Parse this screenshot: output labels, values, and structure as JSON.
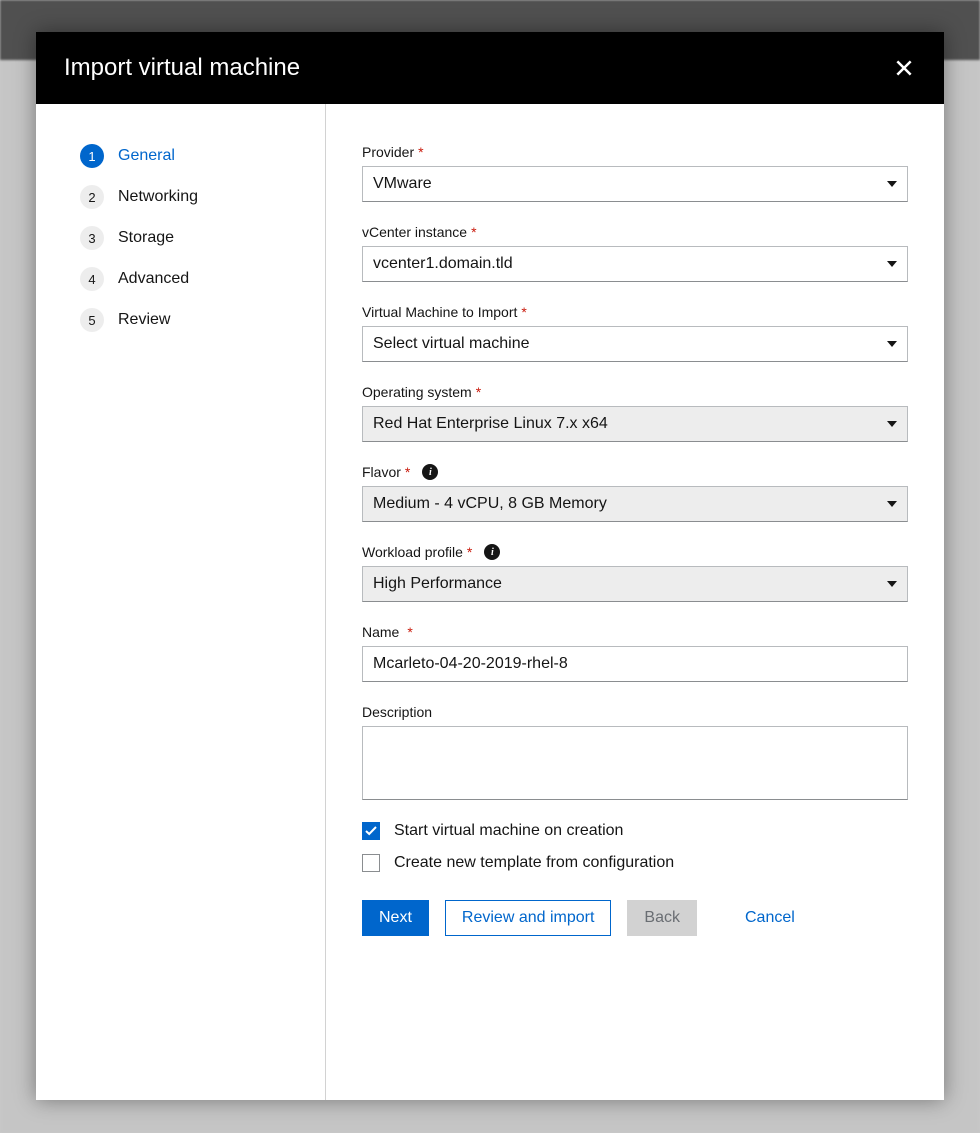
{
  "modal": {
    "title": "Import virtual machine"
  },
  "sidebar": {
    "steps": [
      {
        "num": "1",
        "label": "General"
      },
      {
        "num": "2",
        "label": "Networking"
      },
      {
        "num": "3",
        "label": "Storage"
      },
      {
        "num": "4",
        "label": "Advanced"
      },
      {
        "num": "5",
        "label": "Review"
      }
    ]
  },
  "form": {
    "provider": {
      "label": "Provider",
      "value": "VMware"
    },
    "vcenter": {
      "label": "vCenter instance",
      "value": "vcenter1.domain.tld"
    },
    "vm": {
      "label": "Virtual Machine to Import",
      "value": "Select virtual machine"
    },
    "os": {
      "label": "Operating system",
      "value": "Red Hat Enterprise Linux 7.x x64"
    },
    "flavor": {
      "label": "Flavor",
      "value": "Medium - 4 vCPU, 8 GB Memory"
    },
    "workload": {
      "label": "Workload profile",
      "value": "High Performance"
    },
    "name": {
      "label": "Name",
      "value": "Mcarleto-04-20-2019-rhel-8"
    },
    "description": {
      "label": "Description",
      "value": ""
    },
    "startOnCreate": {
      "label": "Start virtual machine on creation"
    },
    "createTemplate": {
      "label": "Create new template from configuration"
    }
  },
  "buttons": {
    "next": "Next",
    "review": "Review and import",
    "back": "Back",
    "cancel": "Cancel"
  }
}
